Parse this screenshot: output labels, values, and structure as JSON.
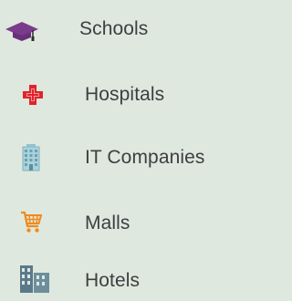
{
  "colors": {
    "background": "#dfe8de",
    "text": "#3c3f42",
    "graduation_cap": "#7b3b8c",
    "hospital_cross": "#e0242b",
    "building": "#8fc3cf",
    "cart": "#f08a1e",
    "hotel_building": "#5a7a8a"
  },
  "menu": {
    "items": [
      {
        "label": "Schools",
        "icon": "graduation-cap-icon"
      },
      {
        "label": "Hospitals",
        "icon": "hospital-cross-icon"
      },
      {
        "label": "IT Companies",
        "icon": "office-building-icon"
      },
      {
        "label": "Malls",
        "icon": "shopping-cart-icon"
      },
      {
        "label": "Hotels",
        "icon": "hotel-building-icon"
      }
    ]
  }
}
